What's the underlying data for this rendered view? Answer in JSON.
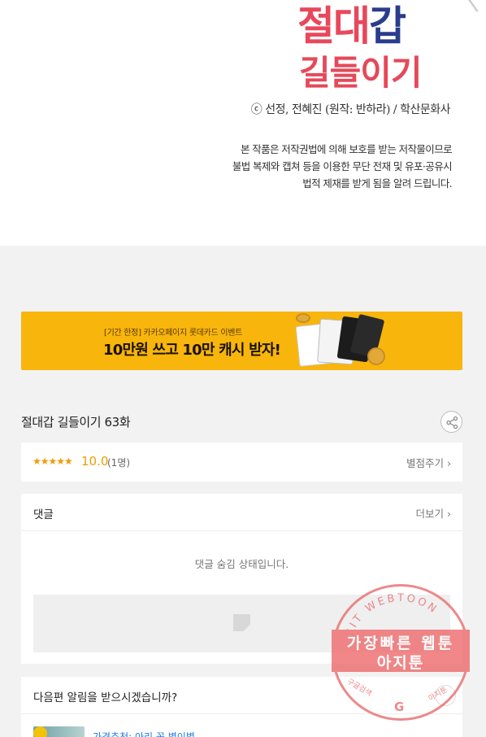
{
  "comic": {
    "title_line1_part1": "절대",
    "title_line1_part2": "갑",
    "title_line2": "길들이기",
    "credits": "ⓒ 선정, 전혜진 (원작: 반하라) / 학산문화사",
    "copyright_lines": [
      "본 작품은 저작권법에 의해 보호를 받는 저작물이므로",
      "불법 복제와 캡쳐 등을 이용한 무단 전재 및 유포·공유시",
      "법적 제재를 받게 됨을 알려 드립니다."
    ]
  },
  "banner": {
    "subtitle": "[기간 한정] 카카오페이지 롯데카드 이벤트",
    "headline": "10만원 쓰고 10만 캐시 받자!",
    "accent_color": "#f8b50c"
  },
  "episode": {
    "title": "절대갑 길들이기 63화",
    "share_icon": "share-icon"
  },
  "rating": {
    "stars": "★★★★★",
    "score": "10.0",
    "count": "(1명)",
    "rate_link": "별점주기 ›"
  },
  "comments": {
    "label": "댓글",
    "more_link": "더보기 ›",
    "hidden_message": "댓글 숨김 상태입니다."
  },
  "alert": {
    "label": "다음편 알림을 받으시겠습니까?",
    "next_link": "가격추천: 아리 꼭 별이별"
  },
  "watermark": {
    "arc_text": "AGIT WEBTOON",
    "line1": "가장빠른 웹툰",
    "line2": "아지툰",
    "bottom_left": "구글검색",
    "bottom_right": "아지툰",
    "g_letter": "G"
  }
}
